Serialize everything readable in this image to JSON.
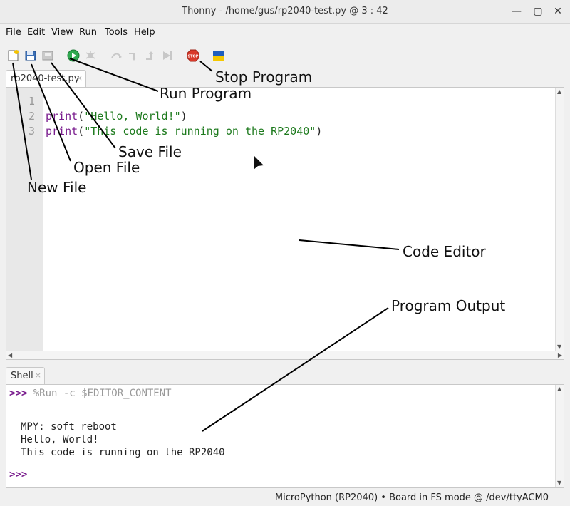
{
  "window": {
    "title": "Thonny  -  /home/gus/rp2040-test.py  @  3 : 42",
    "minimize_glyph": "—",
    "maximize_glyph": "▢",
    "close_glyph": "✕"
  },
  "menu": {
    "items": [
      {
        "label": "File"
      },
      {
        "label": "Edit"
      },
      {
        "label": "View"
      },
      {
        "label": "Run"
      },
      {
        "label": "Tools"
      },
      {
        "label": "Help"
      }
    ]
  },
  "toolbar": {
    "icons": [
      "new-file-icon",
      "open-file-icon",
      "save-file-icon",
      "run-program-icon",
      "debug-icon",
      "step-over-icon",
      "step-into-icon",
      "step-out-icon",
      "resume-icon",
      "stop-program-icon",
      "ukraine-flag-icon"
    ],
    "stop_label": "STOP",
    "colors": {
      "run": "#2fa84f",
      "stop": "#d93a2b",
      "flag_blue": "#1f5fbf",
      "flag_yellow": "#f5c800"
    }
  },
  "editor": {
    "tab_label": "rp2040-test.py",
    "tab_close": "×",
    "line_numbers": [
      "1",
      "2",
      "3"
    ],
    "lines": [
      {
        "text": ""
      },
      {
        "kw": "print",
        "open": "(",
        "str": "\"Hello, World!\"",
        "close": ")"
      },
      {
        "kw": "print",
        "open": "(",
        "str": "\"This code is running on the RP2040\"",
        "close": ")"
      }
    ]
  },
  "shell": {
    "tab_label": "Shell",
    "tab_close": "×",
    "prompt": ">>>",
    "command": "%Run -c $EDITOR_CONTENT",
    "output": [
      "MPY: soft reboot",
      "Hello, World!",
      "This code is running on the RP2040"
    ]
  },
  "status": {
    "text": "MicroPython (RP2040)  •  Board in FS mode @ /dev/ttyACM0"
  },
  "annotations": {
    "stop_program": "Stop Program",
    "run_program": "Run Program",
    "save_file": "Save File",
    "open_file": "Open File",
    "new_file": "New File",
    "code_editor": "Code Editor",
    "program_output": "Program Output"
  }
}
